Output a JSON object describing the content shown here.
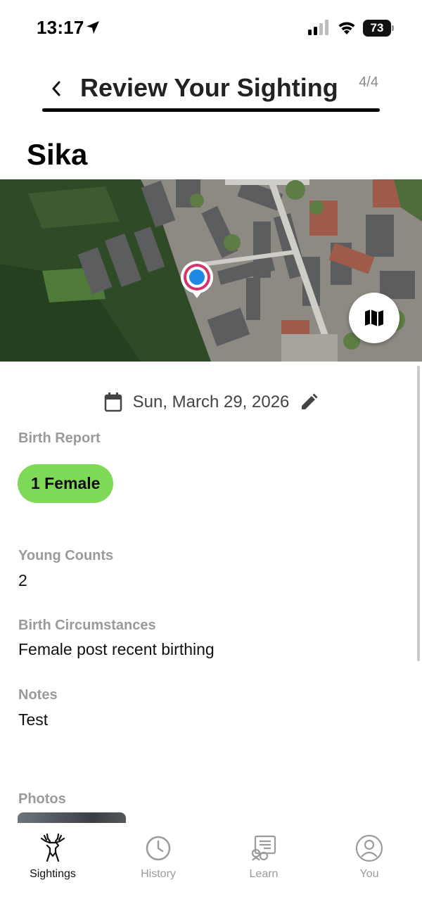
{
  "status_bar": {
    "time": "13:17",
    "battery": "73"
  },
  "header": {
    "title": "Review Your Sighting",
    "step": "4/4"
  },
  "species": "Sika",
  "date": {
    "value": "Sun, March 29, 2026"
  },
  "birth_report": {
    "label": "Birth Report",
    "chip": "1 Female"
  },
  "young_counts": {
    "label": "Young Counts",
    "value": "2"
  },
  "birth_circumstances": {
    "label": "Birth Circumstances",
    "value": "Female post recent birthing"
  },
  "notes": {
    "label": "Notes",
    "value": "Test"
  },
  "photos": {
    "label": "Photos"
  },
  "tabs": [
    {
      "label": "Sightings",
      "icon": "deer-icon",
      "active": true
    },
    {
      "label": "History",
      "icon": "clock-icon",
      "active": false
    },
    {
      "label": "Learn",
      "icon": "learn-icon",
      "active": false
    },
    {
      "label": "You",
      "icon": "user-icon",
      "active": false
    }
  ],
  "colors": {
    "chip": "#7ed957",
    "pin_ring": "#d6336c",
    "pin_dot": "#1e88e5"
  }
}
